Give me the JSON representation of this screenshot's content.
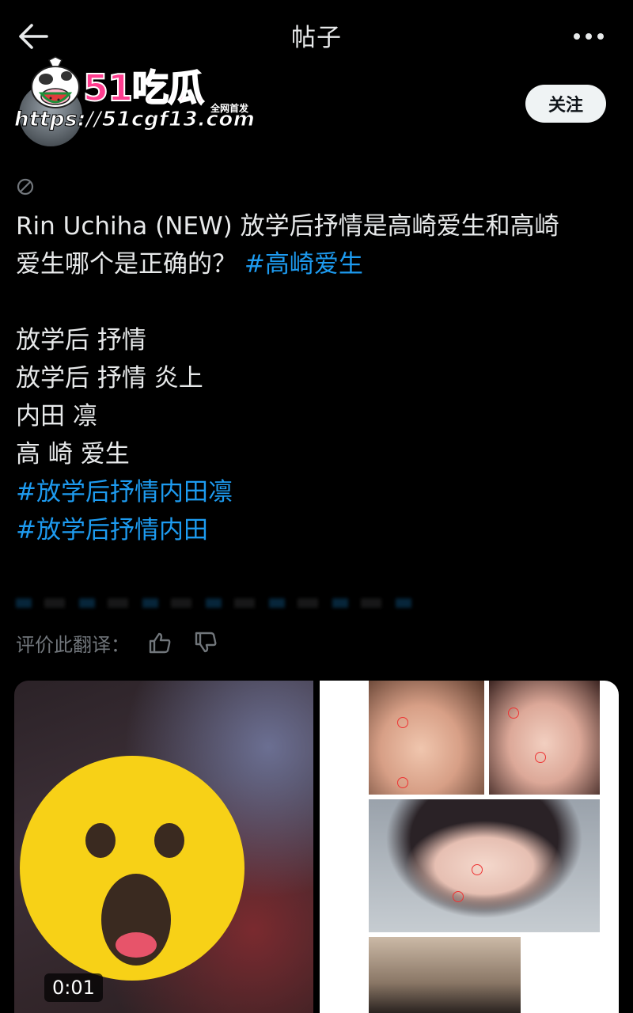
{
  "nav": {
    "title": "帖子"
  },
  "watermark": {
    "brand": "51吃瓜",
    "sub": "全网首发",
    "url": "https://51cgf13.com"
  },
  "author": {
    "follow_label": "关注"
  },
  "post": {
    "line1_text": "Rin Uchiha (NEW) 放学后抒情是高崎爱生和高崎",
    "line2_text": "爱生哪个是正确的？ ",
    "line2_hashtag": "#高崎爱生",
    "line3": "放学后 抒情",
    "line4": "放学后 抒情 炎上",
    "line5": "内田 凛",
    "line6": "高 崎 爱生",
    "hashtag_a": "#放学后抒情内田凛",
    "hashtag_b": "#放学后抒情内田"
  },
  "translation": {
    "rate_label": "评价此翻译："
  },
  "media": {
    "video_duration": "0:01"
  },
  "colors": {
    "background": "#000000",
    "text": "#e7e9ea",
    "hashtag": "#1d9bf0",
    "muted": "#71767b",
    "follow_bg": "#eff3f4"
  }
}
